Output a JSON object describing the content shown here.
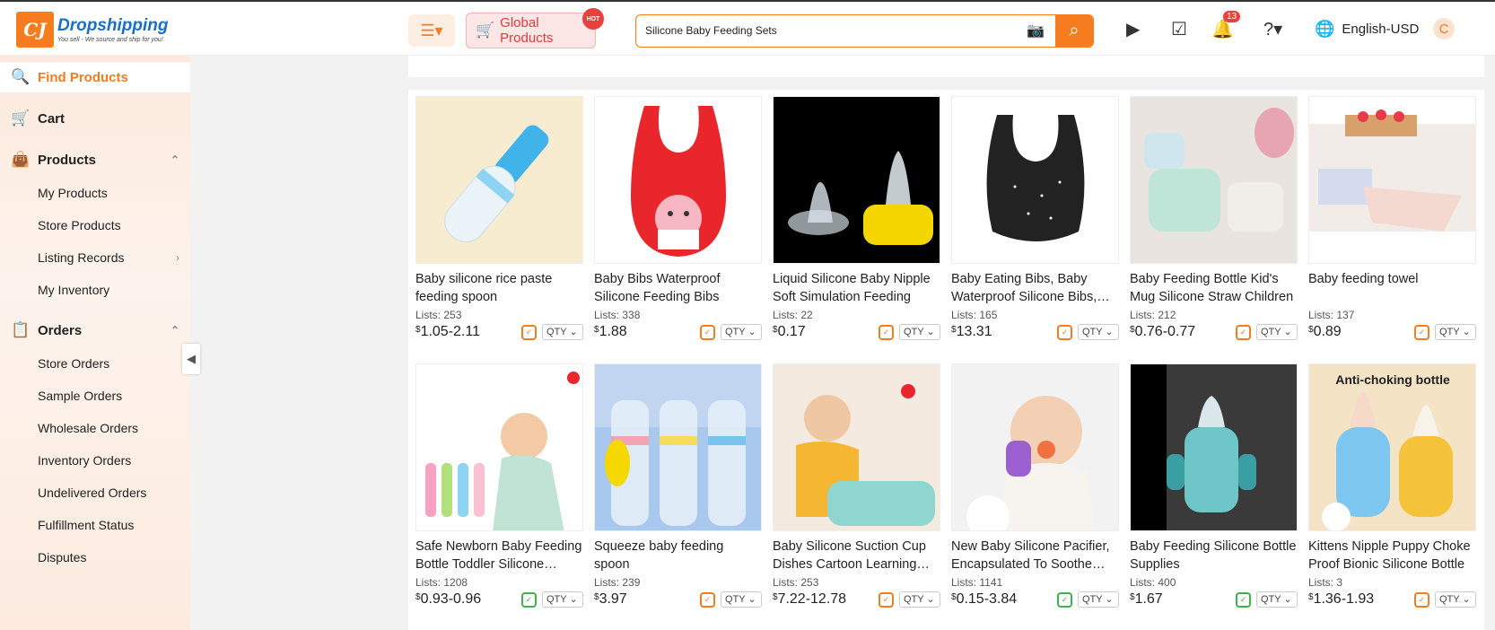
{
  "brand": {
    "name": "Dropshipping",
    "tagline": "You sell - We source and ship for you!",
    "logo_letters": "CJ"
  },
  "header": {
    "global_products": "Global Products",
    "hot": "HOT",
    "search_value": "Silicone Baby Feeding Sets",
    "notifications": "13",
    "language": "English-USD",
    "avatar_letter": "C"
  },
  "sidebar": {
    "items": [
      {
        "label": "Find Products",
        "icon": "find-products-icon",
        "type": "main",
        "active": true
      },
      {
        "label": "Cart",
        "icon": "cart-icon",
        "type": "main"
      },
      {
        "label": "Products",
        "icon": "products-bag-icon",
        "type": "main",
        "expanded": true
      },
      {
        "label": "My Products",
        "type": "sub"
      },
      {
        "label": "Store Products",
        "type": "sub"
      },
      {
        "label": "Listing Records",
        "type": "sub",
        "has_arrow": true
      },
      {
        "label": "My Inventory",
        "type": "sub"
      },
      {
        "label": "Orders",
        "icon": "orders-icon",
        "type": "main",
        "expanded": true
      },
      {
        "label": "Store Orders",
        "type": "sub"
      },
      {
        "label": "Sample Orders",
        "type": "sub"
      },
      {
        "label": "Wholesale Orders",
        "type": "sub"
      },
      {
        "label": "Inventory Orders",
        "type": "sub"
      },
      {
        "label": "Undelivered Orders",
        "type": "sub"
      },
      {
        "label": "Fulfillment Status",
        "type": "sub"
      },
      {
        "label": "Disputes",
        "type": "sub"
      }
    ]
  },
  "lists_label": "Lists:",
  "qty_label": "QTY",
  "products": [
    {
      "title": "Baby silicone rice paste feeding spoon",
      "lists": "253",
      "price": "1.05-2.11",
      "shield": "orange",
      "img": "spoon"
    },
    {
      "title": "Baby Bibs Waterproof Silicone Feeding Bibs",
      "lists": "338",
      "price": "1.88",
      "shield": "orange",
      "img": "redbib"
    },
    {
      "title": "Liquid Silicone Baby Nipple Soft Simulation Feeding",
      "lists": "22",
      "price": "0.17",
      "shield": "orange",
      "img": "nipple"
    },
    {
      "title": "Baby Eating Bibs, Baby Waterproof Silicone Bibs, Soft",
      "lists": "165",
      "price": "13.31",
      "shield": "orange",
      "img": "blackbib"
    },
    {
      "title": "Baby Feeding Bottle Kid's Mug Silicone Straw Children",
      "lists": "212",
      "price": "0.76-0.77",
      "shield": "orange",
      "img": "mugs"
    },
    {
      "title": "Baby feeding towel",
      "lists": "137",
      "price": "0.89",
      "shield": "orange",
      "img": "towel"
    },
    {
      "title": "Safe Newborn Baby Feeding Bottle Toddler Silicone Squeeze",
      "lists": "1208",
      "price": "0.93-0.96",
      "shield": "green",
      "img": "babyspoon"
    },
    {
      "title": "Squeeze baby feeding spoon",
      "lists": "239",
      "price": "3.97",
      "shield": "orange",
      "img": "bottles"
    },
    {
      "title": "Baby Silicone Suction Cup Dishes Cartoon Learning Plate",
      "lists": "253",
      "price": "7.22-12.78",
      "shield": "orange",
      "img": "plate"
    },
    {
      "title": "New Baby Silicone Pacifier, Encapsulated To Soothe Teething",
      "lists": "1141",
      "price": "0.15-3.84",
      "shield": "green",
      "img": "pacifier"
    },
    {
      "title": "Baby Feeding Silicone Bottle Supplies",
      "lists": "400",
      "price": "1.67",
      "shield": "green",
      "img": "tealbottle"
    },
    {
      "title": "Kittens Nipple Puppy Choke Proof Bionic Silicone Bottle",
      "lists": "3",
      "price": "1.36-1.93",
      "shield": "orange",
      "img": "anticho",
      "img_text": "Anti-choking bottle"
    }
  ]
}
